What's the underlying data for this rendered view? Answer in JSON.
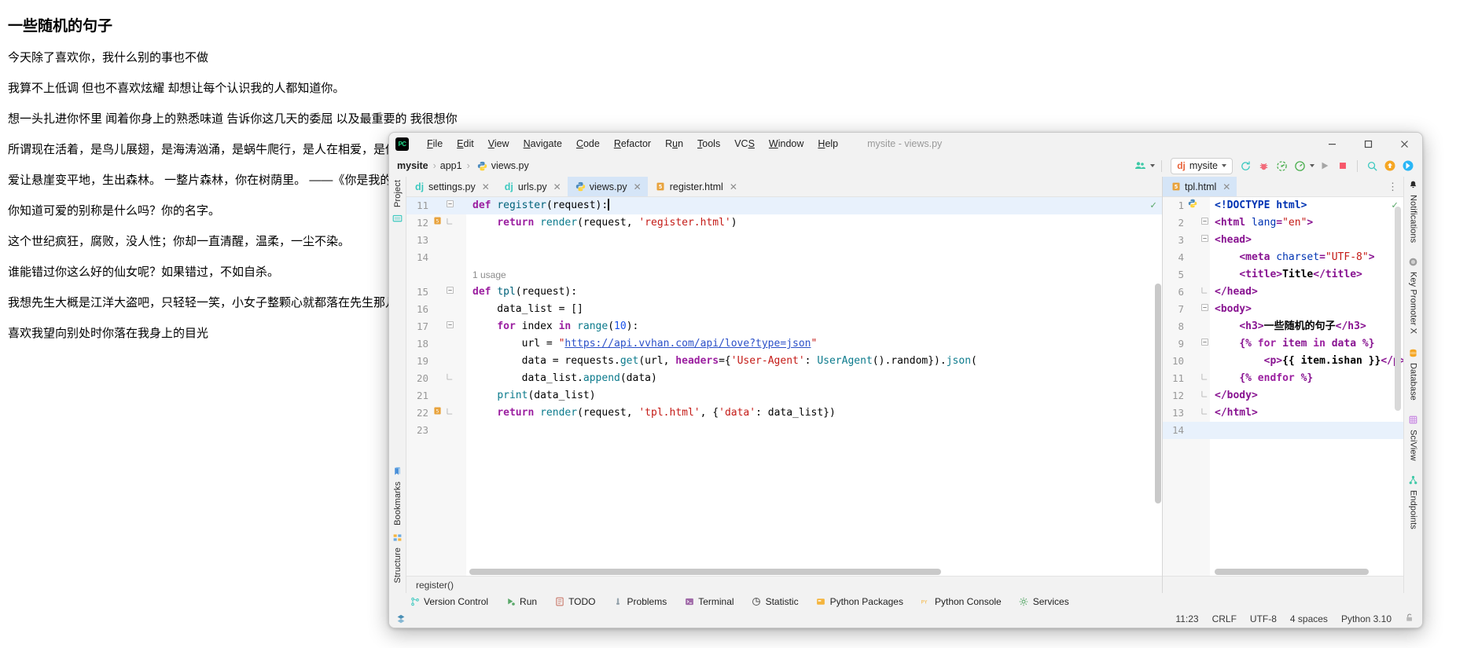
{
  "webpage": {
    "heading": "一些随机的句子",
    "lines": [
      "今天除了喜欢你，我什么别的事也不做",
      "我算不上低调 但也不喜欢炫耀 却想让每个认识我的人都知道你。",
      "想一头扎进你怀里 闻着你身上的熟悉味道 告诉你这几天的委屈 以及最重要的 我很想你",
      "所谓现在活着，是鸟儿展翅，是海涛汹涌，是蜗牛爬行，是人在相爱，是你的手温，是生命。",
      "爱让悬崖变平地，生出森林。 一整片森林，你在树荫里。 ——《你是我的风景》",
      "你知道可爱的别称是什么吗？你的名字。",
      "这个世纪疯狂，腐败，没人性；你却一直清醒，温柔，一尘不染。",
      "谁能错过你这么好的仙女呢？如果错过，不如自杀。",
      "我想先生大概是江洋大盗吧，只轻轻一笑，小女子整颗心就都落在先生那儿",
      "喜欢我望向别处时你落在我身上的目光"
    ]
  },
  "ide": {
    "logo_text": "PC",
    "window_title": "mysite - views.py",
    "menu": [
      {
        "pre": "",
        "u": "F",
        "post": "ile"
      },
      {
        "pre": "",
        "u": "E",
        "post": "dit"
      },
      {
        "pre": "",
        "u": "V",
        "post": "iew"
      },
      {
        "pre": "",
        "u": "N",
        "post": "avigate"
      },
      {
        "pre": "",
        "u": "C",
        "post": "ode"
      },
      {
        "pre": "",
        "u": "R",
        "post": "efactor"
      },
      {
        "pre": "R",
        "u": "u",
        "post": "n"
      },
      {
        "pre": "",
        "u": "T",
        "post": "ools"
      },
      {
        "pre": "VC",
        "u": "S",
        "post": ""
      },
      {
        "pre": "",
        "u": "W",
        "post": "indow"
      },
      {
        "pre": "",
        "u": "H",
        "post": "elp"
      }
    ],
    "window_controls": {
      "minimize": "minimize-button",
      "maximize": "maximize-button",
      "close": "close-button"
    },
    "breadcrumb": [
      "mysite",
      "app1",
      "views.py"
    ],
    "toolbar": {
      "run_config": "mysite",
      "run_config_prefix": "dj",
      "buttons": [
        "users-icon",
        "reload-icon",
        "bug-icon",
        "coverage-icon",
        "profile-icon",
        "run-icon",
        "stop-icon",
        "search-icon",
        "update-icon",
        "ai-icon"
      ]
    },
    "left_strip": [
      "Project",
      "Structure",
      "Bookmarks"
    ],
    "right_strip": [
      "Notifications",
      "Key Promoter X",
      "Database",
      "SciView",
      "Endpoints"
    ],
    "left_pane": {
      "tabs": [
        {
          "label": "settings.py",
          "icon": "dj",
          "active": false
        },
        {
          "label": "urls.py",
          "icon": "dj",
          "active": false
        },
        {
          "label": "views.py",
          "icon": "py",
          "active": true
        },
        {
          "label": "register.html",
          "icon": "html",
          "active": false
        }
      ],
      "status_breadcrumb": "register()"
    },
    "right_pane": {
      "tabs": [
        {
          "label": "tpl.html",
          "icon": "html",
          "active": true
        }
      ]
    },
    "tool_windows": [
      {
        "label": "Version Control",
        "icon": "branch-icon"
      },
      {
        "label": "Run",
        "icon": "run-icon"
      },
      {
        "label": "TODO",
        "icon": "todo-icon"
      },
      {
        "label": "Problems",
        "icon": "problems-icon"
      },
      {
        "label": "Terminal",
        "icon": "terminal-icon"
      },
      {
        "label": "Statistic",
        "icon": "statistic-icon"
      },
      {
        "label": "Python Packages",
        "icon": "packages-icon"
      },
      {
        "label": "Python Console",
        "icon": "console-icon"
      },
      {
        "label": "Services",
        "icon": "services-icon"
      }
    ],
    "statusbar": {
      "position": "11:23",
      "line_separator": "CRLF",
      "encoding": "UTF-8",
      "indent": "4 spaces",
      "interpreter": "Python 3.10",
      "lock": "lock-icon"
    }
  },
  "code_python": {
    "lines": [
      {
        "n": "11",
        "fold": "minus",
        "gicon": "",
        "hl": true,
        "tokens": [
          {
            "t": "def ",
            "c": "kw"
          },
          {
            "t": "register",
            "c": "fn"
          },
          {
            "t": "(request):",
            "c": ""
          }
        ],
        "caret": true
      },
      {
        "n": "12",
        "fold": "end",
        "gicon": "html",
        "hl": false,
        "tokens": [
          {
            "t": "    ",
            "c": ""
          },
          {
            "t": "return ",
            "c": "kw"
          },
          {
            "t": "render",
            "c": "fn2"
          },
          {
            "t": "(request, ",
            "c": ""
          },
          {
            "t": "'register.html'",
            "c": "st"
          },
          {
            "t": ")",
            "c": ""
          }
        ]
      },
      {
        "n": "13",
        "fold": "",
        "gicon": "",
        "hl": false,
        "tokens": []
      },
      {
        "n": "14",
        "fold": "",
        "gicon": "",
        "hl": false,
        "tokens": []
      },
      {
        "n": "",
        "fold": "",
        "gicon": "",
        "hl": false,
        "usage": "1 usage",
        "tokens": []
      },
      {
        "n": "15",
        "fold": "minus",
        "gicon": "",
        "hl": false,
        "tokens": [
          {
            "t": "def ",
            "c": "kw"
          },
          {
            "t": "tpl",
            "c": "fn"
          },
          {
            "t": "(request):",
            "c": ""
          }
        ]
      },
      {
        "n": "16",
        "fold": "",
        "gicon": "",
        "hl": false,
        "tokens": [
          {
            "t": "    data_list = []",
            "c": ""
          }
        ]
      },
      {
        "n": "17",
        "fold": "minus",
        "gicon": "",
        "hl": false,
        "tokens": [
          {
            "t": "    ",
            "c": ""
          },
          {
            "t": "for ",
            "c": "kw"
          },
          {
            "t": "index ",
            "c": ""
          },
          {
            "t": "in ",
            "c": "kw"
          },
          {
            "t": "range",
            "c": "fn2"
          },
          {
            "t": "(",
            "c": ""
          },
          {
            "t": "10",
            "c": "nu"
          },
          {
            "t": "):",
            "c": ""
          }
        ]
      },
      {
        "n": "18",
        "fold": "",
        "gicon": "",
        "hl": false,
        "tokens": [
          {
            "t": "        url = ",
            "c": ""
          },
          {
            "t": "\"",
            "c": "st"
          },
          {
            "t": "https://api.vvhan.com/api/love?type=json",
            "c": "lnk"
          },
          {
            "t": "\"",
            "c": "st"
          }
        ]
      },
      {
        "n": "19",
        "fold": "",
        "gicon": "",
        "hl": false,
        "tokens": [
          {
            "t": "        data = requests.",
            "c": ""
          },
          {
            "t": "get",
            "c": "fn2"
          },
          {
            "t": "(url, ",
            "c": ""
          },
          {
            "t": "headers",
            "c": "kw"
          },
          {
            "t": "={",
            "c": ""
          },
          {
            "t": "'User-Agent'",
            "c": "st"
          },
          {
            "t": ": ",
            "c": ""
          },
          {
            "t": "UserAgent",
            "c": "fn2"
          },
          {
            "t": "()",
            "c": ""
          },
          {
            "t": ".random}).",
            "c": ""
          },
          {
            "t": "json",
            "c": "fn2"
          },
          {
            "t": "(",
            "c": ""
          }
        ]
      },
      {
        "n": "20",
        "fold": "end",
        "gicon": "",
        "hl": false,
        "tokens": [
          {
            "t": "        data_list.",
            "c": ""
          },
          {
            "t": "append",
            "c": "fn2"
          },
          {
            "t": "(data)",
            "c": ""
          }
        ]
      },
      {
        "n": "21",
        "fold": "",
        "gicon": "",
        "hl": false,
        "tokens": [
          {
            "t": "    ",
            "c": ""
          },
          {
            "t": "print",
            "c": "fn2"
          },
          {
            "t": "(data_list)",
            "c": ""
          }
        ]
      },
      {
        "n": "22",
        "fold": "end",
        "gicon": "html",
        "hl": false,
        "tokens": [
          {
            "t": "    ",
            "c": ""
          },
          {
            "t": "return ",
            "c": "kw"
          },
          {
            "t": "render",
            "c": "fn2"
          },
          {
            "t": "(request, ",
            "c": ""
          },
          {
            "t": "'tpl.html'",
            "c": "st"
          },
          {
            "t": ", {",
            "c": ""
          },
          {
            "t": "'data'",
            "c": "st"
          },
          {
            "t": ": data_list})",
            "c": ""
          }
        ]
      },
      {
        "n": "23",
        "fold": "",
        "gicon": "",
        "hl": false,
        "tokens": []
      }
    ]
  },
  "code_html": {
    "lines": [
      {
        "n": "1",
        "fold": "",
        "gicon": "py",
        "hl": false,
        "check": true,
        "tokens": [
          {
            "t": "<!DOCTYPE html>",
            "c": "tagn"
          }
        ]
      },
      {
        "n": "2",
        "fold": "minus",
        "gicon": "",
        "hl": false,
        "tokens": [
          {
            "t": "<html ",
            "c": "tag"
          },
          {
            "t": "lang",
            "c": "attr"
          },
          {
            "t": "=",
            "c": "tag"
          },
          {
            "t": "\"en\"",
            "c": "aval"
          },
          {
            "t": ">",
            "c": "tag"
          }
        ]
      },
      {
        "n": "3",
        "fold": "minus",
        "gicon": "",
        "hl": false,
        "tokens": [
          {
            "t": "<head>",
            "c": "tag"
          }
        ]
      },
      {
        "n": "4",
        "fold": "",
        "gicon": "",
        "hl": false,
        "tokens": [
          {
            "t": "    ",
            "c": ""
          },
          {
            "t": "<meta ",
            "c": "tag"
          },
          {
            "t": "charset",
            "c": "attr"
          },
          {
            "t": "=",
            "c": "tag"
          },
          {
            "t": "\"UTF-8\"",
            "c": "aval"
          },
          {
            "t": ">",
            "c": "tag"
          }
        ]
      },
      {
        "n": "5",
        "fold": "",
        "gicon": "",
        "hl": false,
        "tokens": [
          {
            "t": "    ",
            "c": ""
          },
          {
            "t": "<title>",
            "c": "tag"
          },
          {
            "t": "Title",
            "c": "df"
          },
          {
            "t": "</title>",
            "c": "tag"
          }
        ]
      },
      {
        "n": "6",
        "fold": "end",
        "gicon": "",
        "hl": false,
        "tokens": [
          {
            "t": "</head>",
            "c": "tag"
          }
        ]
      },
      {
        "n": "7",
        "fold": "minus",
        "gicon": "",
        "hl": false,
        "tokens": [
          {
            "t": "<body>",
            "c": "tag"
          }
        ]
      },
      {
        "n": "8",
        "fold": "",
        "gicon": "",
        "hl": false,
        "tokens": [
          {
            "t": "    ",
            "c": ""
          },
          {
            "t": "<h3>",
            "c": "tag"
          },
          {
            "t": "一些随机的句子",
            "c": "df"
          },
          {
            "t": "</h3>",
            "c": "tag"
          }
        ]
      },
      {
        "n": "9",
        "fold": "minus",
        "gicon": "",
        "hl": false,
        "tokens": [
          {
            "t": "    ",
            "c": ""
          },
          {
            "t": "{% ",
            "c": "tpl"
          },
          {
            "t": "for ",
            "c": "kw"
          },
          {
            "t": "item ",
            "c": "tpl"
          },
          {
            "t": "in ",
            "c": "kw"
          },
          {
            "t": "data ",
            "c": "tpl"
          },
          {
            "t": "%}",
            "c": "tpl"
          }
        ]
      },
      {
        "n": "10",
        "fold": "",
        "gicon": "",
        "hl": false,
        "tokens": [
          {
            "t": "        ",
            "c": ""
          },
          {
            "t": "<p>",
            "c": "tag"
          },
          {
            "t": "{{ item.ishan }}",
            "c": "df"
          },
          {
            "t": "</p>",
            "c": "tag"
          }
        ]
      },
      {
        "n": "11",
        "fold": "end",
        "gicon": "",
        "hl": false,
        "tokens": [
          {
            "t": "    ",
            "c": ""
          },
          {
            "t": "{% ",
            "c": "tpl"
          },
          {
            "t": "endfor ",
            "c": "kw"
          },
          {
            "t": "%}",
            "c": "tpl"
          }
        ]
      },
      {
        "n": "12",
        "fold": "end",
        "gicon": "",
        "hl": false,
        "tokens": [
          {
            "t": "</body>",
            "c": "tag"
          }
        ]
      },
      {
        "n": "13",
        "fold": "end",
        "gicon": "",
        "hl": false,
        "tokens": [
          {
            "t": "</html>",
            "c": "tag"
          }
        ]
      },
      {
        "n": "14",
        "fold": "",
        "gicon": "",
        "hl": true,
        "tokens": []
      }
    ]
  }
}
